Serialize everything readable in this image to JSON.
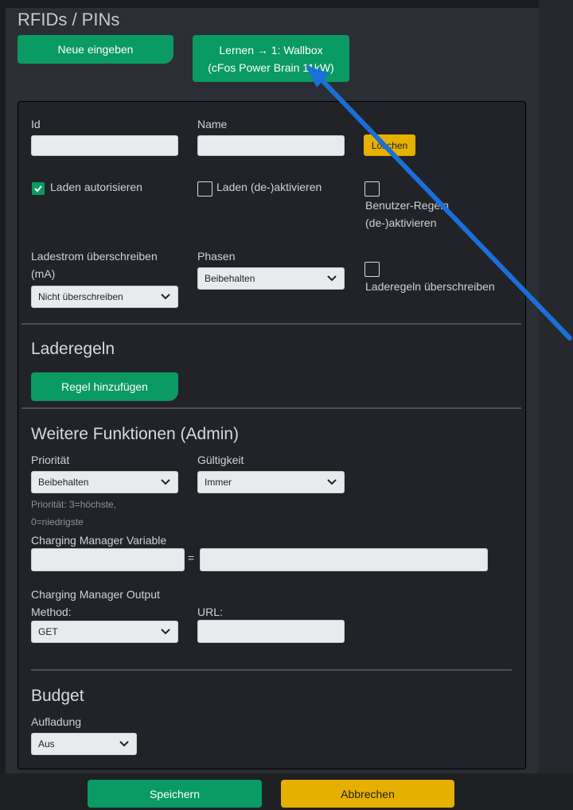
{
  "page_title": "RFIDs / PINs",
  "buttons": {
    "new_entry": "Neue eingeben",
    "learn_line1": "Lernen → 1: Wallbox",
    "learn_line2": "(cFos Power Brain 11kW)",
    "delete": "Löschen",
    "add_rule": "Regel hinzufügen",
    "save": "Speichern",
    "cancel": "Abbrechen"
  },
  "form": {
    "id_label": "Id",
    "id_value": "",
    "name_label": "Name",
    "name_value": "",
    "authorize_label": "Laden autorisieren",
    "authorize_checked": true,
    "activate_label": "Laden (de-)aktivieren",
    "activate_checked": false,
    "user_rules_label_1": "Benutzer-Regeln",
    "user_rules_label_2": "(de-)aktivieren",
    "user_rules_checked": false,
    "current_label_1": "Ladestrom überschreiben",
    "current_label_2": "(mA)",
    "current_value": "Nicht überschreiben",
    "phases_label": "Phasen",
    "phases_value": "Beibehalten",
    "override_rules_label": "Laderegeln überschreiben",
    "override_rules_checked": false
  },
  "charging_rules": {
    "heading": "Laderegeln"
  },
  "admin": {
    "heading": "Weitere Funktionen (Admin)",
    "priority_label": "Priorität",
    "priority_value": "Beibehalten",
    "priority_hint_1": "Priorität: 3=höchste,",
    "priority_hint_2": "0=niedrigste",
    "validity_label": "Gültigkeit",
    "validity_value": "Immer",
    "cm_variable_label": "Charging Manager Variable",
    "cm_variable_name": "",
    "equals": "=",
    "cm_variable_value": "",
    "cm_output_label_1": "Charging Manager Output",
    "cm_output_label_2": "Method:",
    "method_value": "GET",
    "url_label": "URL:",
    "url_value": ""
  },
  "budget": {
    "heading": "Budget",
    "charging_label": "Aufladung",
    "charging_value": "Aus"
  },
  "colors": {
    "accent_green": "#0a9a63",
    "warning_yellow": "#e6b000",
    "annotation_arrow": "#1a6fd8"
  }
}
